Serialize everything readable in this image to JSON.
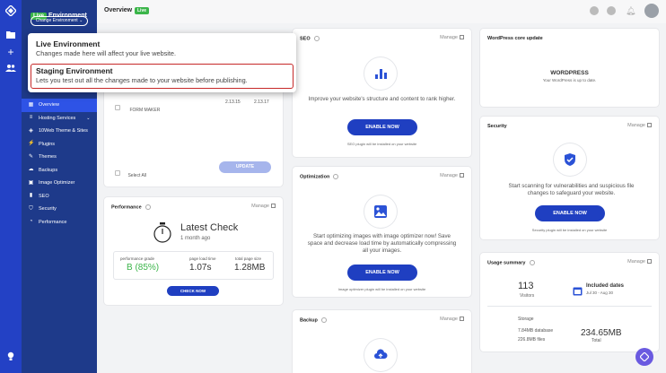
{
  "sidebar": {
    "env_badge": "Live",
    "env_title": "Environment",
    "change_env": "Change Environment ⌄",
    "items": [
      {
        "label": "Overview",
        "icon": "grid-icon"
      },
      {
        "label": "Hosting Services",
        "icon": "server-icon"
      },
      {
        "label": "10Web Theme & Sites",
        "icon": "layers-icon"
      },
      {
        "label": "Plugins",
        "icon": "plug-icon"
      },
      {
        "label": "Themes",
        "icon": "brush-icon"
      },
      {
        "label": "Backups",
        "icon": "cloud-icon"
      },
      {
        "label": "Image Optimizer",
        "icon": "image-icon"
      },
      {
        "label": "SEO",
        "icon": "bar-chart-icon"
      },
      {
        "label": "Security",
        "icon": "shield-icon"
      },
      {
        "label": "Performance",
        "icon": "gauge-icon"
      }
    ]
  },
  "header": {
    "title": "Overview",
    "badge": "Live"
  },
  "dropdown": {
    "live_title": "Live Environment",
    "live_desc": "Changes made here will affect your live website.",
    "staging_title": "Staging Environment",
    "staging_desc": "Lets you test out all the changes made to your website before publishing."
  },
  "plugins_card": {
    "row_name": "FORM MAKER",
    "row_v1": "2.13.15",
    "row_v2": "2.13.17",
    "select_all": "Select All",
    "update": "UPDATE"
  },
  "performance": {
    "title": "Performance",
    "manage": "Manage",
    "latest": "Latest Check",
    "ago": "1 month ago",
    "grade_label": "performance grade",
    "grade": "B (85%)",
    "load_label": "page load time",
    "load": "1.07s",
    "size_label": "total page size",
    "size": "1.28MB",
    "check_now": "CHECK NOW"
  },
  "seo": {
    "title": "SEO",
    "manage": "Manage",
    "text": "Improve your website's structure and content to rank higher.",
    "button": "ENABLE NOW",
    "fine": "SEO plugin will be installed on your website"
  },
  "optimization": {
    "title": "Optimization",
    "manage": "Manage",
    "text": "Start optimizing images with image optimizer now! Save space and decrease load time by automatically compressing all your images.",
    "button": "ENABLE NOW",
    "fine": "Image optimizer plugin will be installed on your website"
  },
  "backup": {
    "title": "Backup",
    "manage": "Manage"
  },
  "wp_core": {
    "title": "WordPress core update",
    "name": "WORDPRESS",
    "status": "Your WordPress is up to date."
  },
  "security": {
    "title": "Security",
    "manage": "Manage",
    "text": "Start scanning for vulnerabilities and suspicious file changes to safeguard your website.",
    "button": "ENABLE NOW",
    "fine": "Security plugin will be installed on your website"
  },
  "usage": {
    "title": "Usage summary",
    "manage": "Manage",
    "visitors": "113",
    "visitors_label": "Visitors",
    "dates_label": "Included dates",
    "dates": "Jul 30 - Aug 30",
    "storage_label": "Storage",
    "db": "7.84MB database",
    "files": "226.8MB files",
    "total": "234.65MB",
    "total_label": "Total"
  },
  "colors": {
    "accent": "#1f3fc1",
    "sidebar": "#1e3a8a",
    "live": "#3bb54a",
    "highlight": "#c62828"
  }
}
